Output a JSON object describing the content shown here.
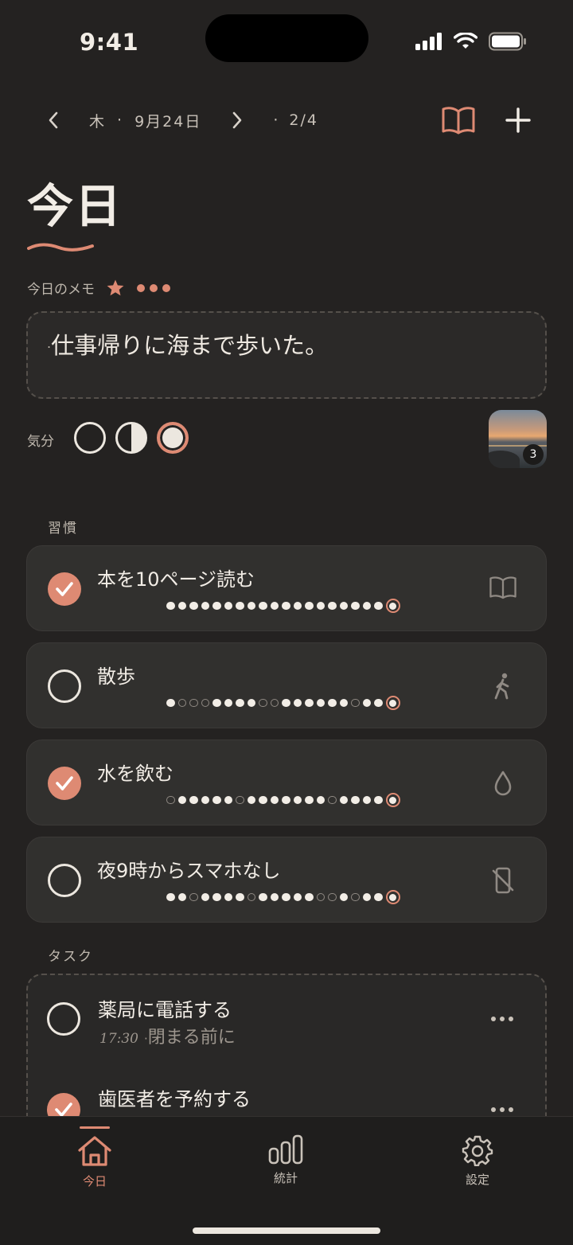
{
  "status_bar": {
    "time": "9:41"
  },
  "nav": {
    "weekday": "木",
    "date": "9月24日",
    "page": "2/4"
  },
  "title": "今日",
  "memo": {
    "label": "今日のメモ",
    "text": "仕事帰りに海まで歩いた。"
  },
  "mood": {
    "label": "気分"
  },
  "photo": {
    "count": "3"
  },
  "habits": {
    "label": "習慣",
    "items": [
      {
        "title": "本を10ページ読む",
        "done": true,
        "icon": "book-icon",
        "history": [
          1,
          1,
          1,
          1,
          1,
          1,
          1,
          1,
          1,
          1,
          1,
          1,
          1,
          1,
          1,
          1,
          1,
          1,
          1,
          1
        ]
      },
      {
        "title": "散歩",
        "done": false,
        "icon": "walk-icon",
        "history": [
          1,
          0,
          0,
          0,
          1,
          1,
          1,
          1,
          0,
          0,
          1,
          1,
          1,
          1,
          1,
          1,
          0,
          1,
          1,
          1
        ]
      },
      {
        "title": "水を飲む",
        "done": true,
        "icon": "water-drop-icon",
        "history": [
          0,
          1,
          1,
          1,
          1,
          1,
          0,
          1,
          1,
          1,
          1,
          1,
          1,
          1,
          0,
          1,
          1,
          1,
          1,
          1
        ]
      },
      {
        "title": "夜9時からスマホなし",
        "done": false,
        "icon": "no-phone-icon",
        "history": [
          1,
          1,
          0,
          1,
          1,
          1,
          1,
          0,
          1,
          1,
          1,
          1,
          1,
          0,
          0,
          1,
          0,
          1,
          1,
          1
        ]
      }
    ]
  },
  "tasks": {
    "label": "タスク",
    "items": [
      {
        "title": "薬局に電話する",
        "time": "17:30",
        "note": "閉まる前に",
        "done": false
      },
      {
        "title": "歯医者を予約する",
        "done": true
      }
    ]
  },
  "tabbar": {
    "today": "今日",
    "stats": "統計",
    "settings": "設定"
  },
  "colors": {
    "accent": "#de8a73",
    "background": "#242221",
    "card": "#31302e"
  }
}
